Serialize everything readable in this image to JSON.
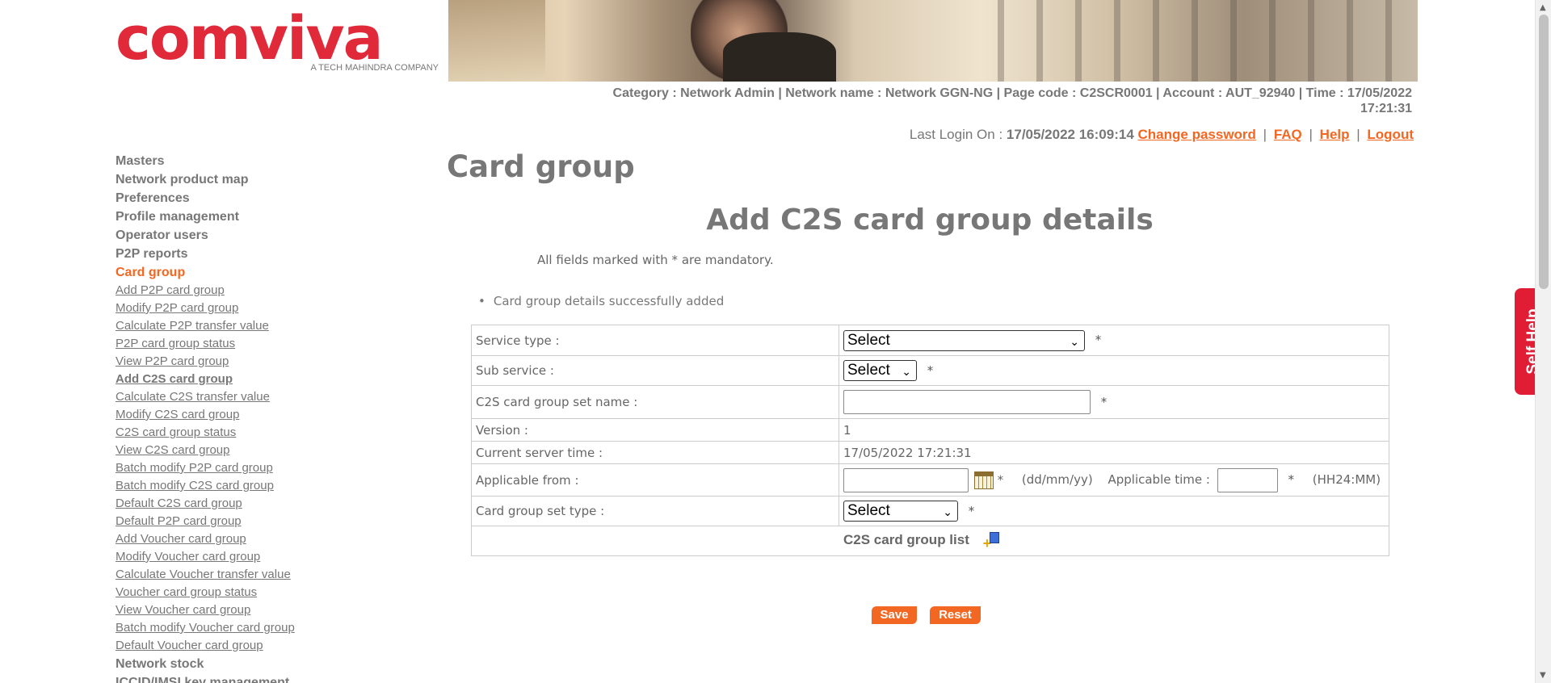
{
  "brand": {
    "logo_text": "comviva",
    "logo_tagline": "A TECH MAHINDRA COMPANY"
  },
  "header": {
    "info_line": "Category : Network Admin | Network name : Network GGN-NG | Page code : C2SCR0001 | Account : AUT_92940 | Time : 17/05/2022",
    "info_time": "17:21:31",
    "last_login_label": "Last Login On :",
    "last_login_value": "17/05/2022 16:09:14",
    "links": {
      "change_password": "Change password",
      "faq": "FAQ",
      "help": "Help",
      "logout": "Logout"
    },
    "separator": "|"
  },
  "sidebar": {
    "sections": [
      "Masters",
      "Network product map",
      "Preferences",
      "Profile management",
      "Operator users",
      "P2P reports"
    ],
    "active_section": "Card group",
    "links": [
      "Add P2P card group",
      "Modify P2P card group",
      "Calculate P2P transfer value",
      "P2P card group status",
      "View P2P card group",
      "Add C2S card group",
      "Calculate C2S transfer value",
      "Modify C2S card group",
      "C2S card group status",
      "View C2S card group",
      "Batch modify P2P card group",
      "Batch modify C2S card group",
      "Default C2S card group",
      "Default P2P card group",
      "Add Voucher card group",
      "Modify Voucher card group",
      "Calculate Voucher transfer value",
      "Voucher card group status",
      "View Voucher card group",
      "Batch modify Voucher card group",
      "Default Voucher card group"
    ],
    "current_link": "Add C2S card group",
    "sections_after": [
      "Network stock",
      "ICCID/IMSI key management"
    ]
  },
  "main": {
    "page_title": "Card group",
    "form_title": "Add C2S card group details",
    "mandatory_note": "All fields marked with * are mandatory.",
    "success_message": "Card group details successfully added",
    "fields": {
      "service_type": {
        "label": "Service type :",
        "value": "Select"
      },
      "sub_service": {
        "label": "Sub service :",
        "value": "Select"
      },
      "set_name": {
        "label": "C2S card group set name :",
        "value": ""
      },
      "version": {
        "label": "Version :",
        "value": "1"
      },
      "server_time": {
        "label": "Current server time :",
        "value": "17/05/2022 17:21:31"
      },
      "applicable_from": {
        "label": "Applicable from :",
        "value": "",
        "format_hint": "(dd/mm/yy)"
      },
      "applicable_time": {
        "label": "Applicable time :",
        "value": "",
        "format_hint": "(HH24:MM)"
      },
      "set_type": {
        "label": "Card group set type :",
        "value": "Select"
      }
    },
    "required_marker": "*",
    "list_label": "C2S card group list",
    "buttons": {
      "save": "Save",
      "reset": "Reset"
    }
  },
  "self_help": "Self Help",
  "colors": {
    "accent": "#f26722",
    "brand_red": "#e02a3a",
    "self_help": "#e11d35"
  },
  "icons": [
    "calendar-icon",
    "add-list-icon",
    "chevron-down-icon"
  ]
}
